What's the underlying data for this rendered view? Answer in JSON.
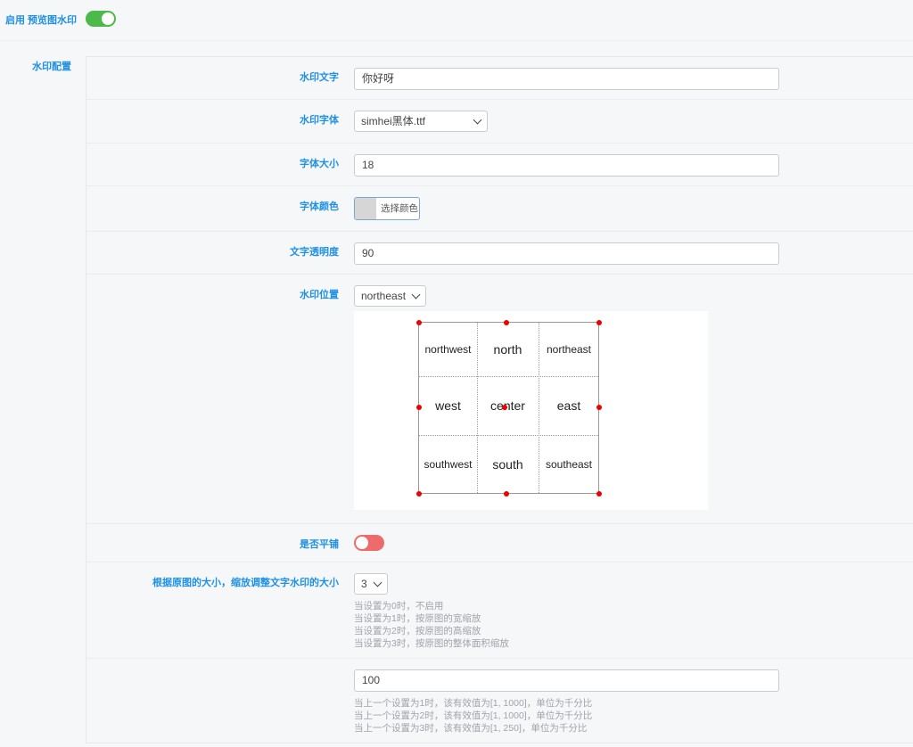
{
  "enable": {
    "label": "启用 预览图水印",
    "on": true,
    "color": "#4cba48"
  },
  "config_label": "水印配置",
  "rows": {
    "text": {
      "label": "水印文字",
      "value": "你好呀"
    },
    "font": {
      "label": "水印字体",
      "value": "simhei黑体.ttf"
    },
    "size": {
      "label": "字体大小",
      "value": "18"
    },
    "color": {
      "label": "字体颜色",
      "button": "选择颜色",
      "swatch": "#d6d6d6"
    },
    "opacity": {
      "label": "文字透明度",
      "value": "90"
    },
    "position": {
      "label": "水印位置",
      "value": "northeast",
      "cells": [
        "northwest",
        "north",
        "northeast",
        "west",
        "center",
        "east",
        "southwest",
        "south",
        "southeast"
      ]
    },
    "tile": {
      "label": "是否平铺",
      "on": false,
      "color": "#ee6b6b"
    },
    "scale": {
      "label": "根据原图的大小，缩放调整文字水印的大小",
      "value": "3",
      "help": [
        "当设置为0时，不启用",
        "当设置为1时，按原图的宽缩放",
        "当设置为2时，按原图的高缩放",
        "当设置为3时，按原图的整体面积缩放"
      ]
    },
    "ratio": {
      "value": "100",
      "help": [
        "当上一个设置为1时，该有效值为[1, 1000]，单位为千分比",
        "当上一个设置为2时，该有效值为[1, 1000]，单位为千分比",
        "当上一个设置为3时，该有效值为[1, 250]，单位为千分比"
      ]
    }
  }
}
